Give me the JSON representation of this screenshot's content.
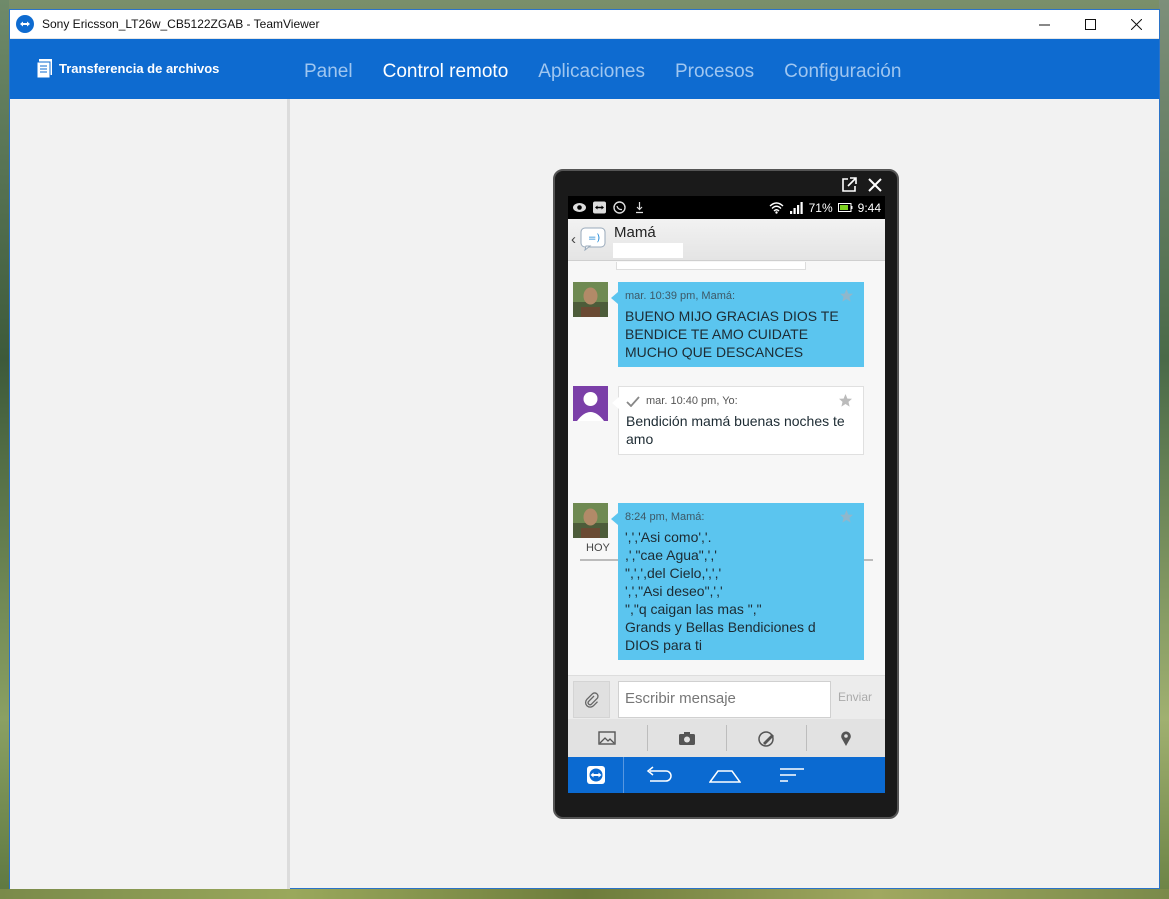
{
  "window": {
    "title": "Sony Ericsson_LT26w_CB5122ZGAB - TeamViewer"
  },
  "nav": {
    "file_transfer": "Transferencia de archivos",
    "tabs": [
      {
        "label": "Panel",
        "active": false
      },
      {
        "label": "Control remoto",
        "active": true
      },
      {
        "label": "Aplicaciones",
        "active": false
      },
      {
        "label": "Procesos",
        "active": false
      },
      {
        "label": "Configuración",
        "active": false
      }
    ]
  },
  "device": {
    "status": {
      "battery": "71%",
      "time": "9:44"
    },
    "conversation": {
      "contact": "Mamá",
      "messages": [
        {
          "direction": "in",
          "meta": "mar. 10:39 pm, Mamá:",
          "text": "BUENO MIJO GRACIAS DIOS TE BENDICE TE AMO CUIDATE MUCHO QUE DESCANCES"
        },
        {
          "direction": "out",
          "meta": "mar. 10:40 pm, Yo:",
          "text": "Bendición mamá buenas noches te amo"
        },
        {
          "direction": "in",
          "meta": "8:24 pm, Mamá:",
          "text": "',','Asi como','.\n,',\"cae Agua\",','\n\",',',del Cielo,',','\n',',\"Asi deseo\",','\n\",\"q caigan las mas \",\"\nGrands y Bellas Bendiciones d\nDIOS  para ti"
        }
      ],
      "day_separator": "HOY",
      "input_placeholder": "Escribir mensaje",
      "send_label": "Enviar"
    }
  },
  "colors": {
    "accent": "#0e6bd0",
    "bubble_in": "#5bc5ef"
  }
}
